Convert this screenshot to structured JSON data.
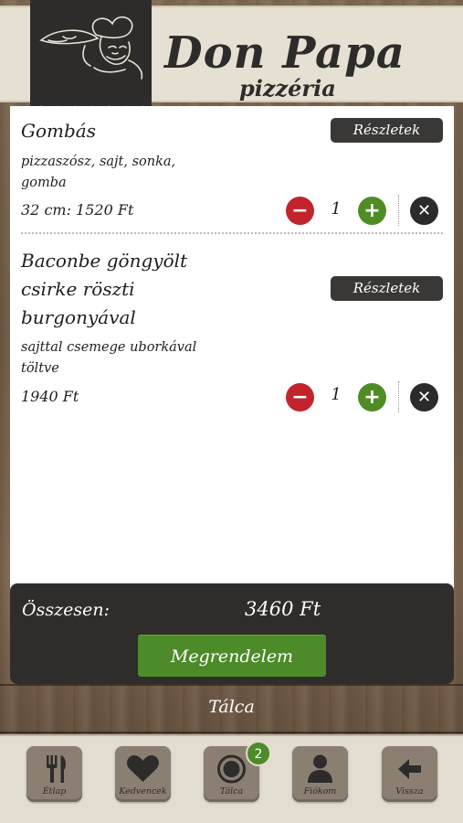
{
  "brand": {
    "title": "Don Papa",
    "subtitle": "pizzéria"
  },
  "items": [
    {
      "title_lines": [
        "Gombás"
      ],
      "desc_lines": [
        "pizzaszósz, sajt, sonka,",
        "gomba"
      ],
      "price": "32 cm: 1520 Ft",
      "quantity": "1",
      "details_label": "Részletek"
    },
    {
      "title_lines": [
        "Baconbe göngyölt",
        "csirke röszti",
        "burgonyával"
      ],
      "desc_lines": [
        "sajttal csemege uborkával",
        "töltve"
      ],
      "price": "1940 Ft",
      "quantity": "1",
      "details_label": "Részletek"
    }
  ],
  "summary": {
    "total_label": "Összesen:",
    "total_value": "3460 Ft",
    "order_button": "Megrendelem"
  },
  "section_title": "Tálca",
  "bottom_nav": {
    "items": [
      {
        "label": "Étlap",
        "icon": "fork-knife-icon"
      },
      {
        "label": "Kedvencek",
        "icon": "heart-icon"
      },
      {
        "label": "Tálca",
        "icon": "tray-icon"
      },
      {
        "label": "Fiókom",
        "icon": "person-icon"
      },
      {
        "label": "Vissza",
        "icon": "arrow-left-icon"
      }
    ],
    "tray_badge": "2"
  },
  "colors": {
    "minus": "#c2242d",
    "plus": "#4f8c26",
    "order_button": "#4d8a29",
    "dark_panel": "#2e2d2b"
  }
}
